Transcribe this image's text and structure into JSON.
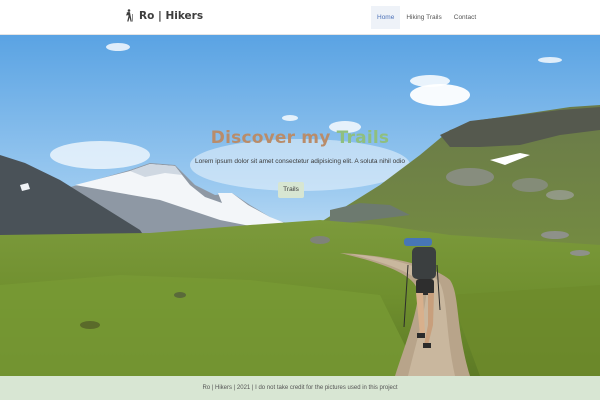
{
  "navbar": {
    "brand_text": "Ro | Hikers",
    "brand_icon": "hiker-icon",
    "items": [
      {
        "label": "Home",
        "active": true
      },
      {
        "label": "Hiking Trails",
        "active": false
      },
      {
        "label": "Contact",
        "active": false
      }
    ]
  },
  "hero": {
    "title_part1": "Discover my",
    "title_part2": "Trails",
    "subtitle": "Lorem ipsum dolor sit amet consectetur adipisicing elit. A soluta nihil odio",
    "button_label": "Trails",
    "colors": {
      "title_primary": "#b98c6a",
      "title_accent": "#8fbf7f",
      "button_bg": "#d7e6d2"
    }
  },
  "footer": {
    "text": "Ro | Hikers | 2021 | I do not take credit for the pictures used in this project",
    "background": "#d8e6d3"
  }
}
